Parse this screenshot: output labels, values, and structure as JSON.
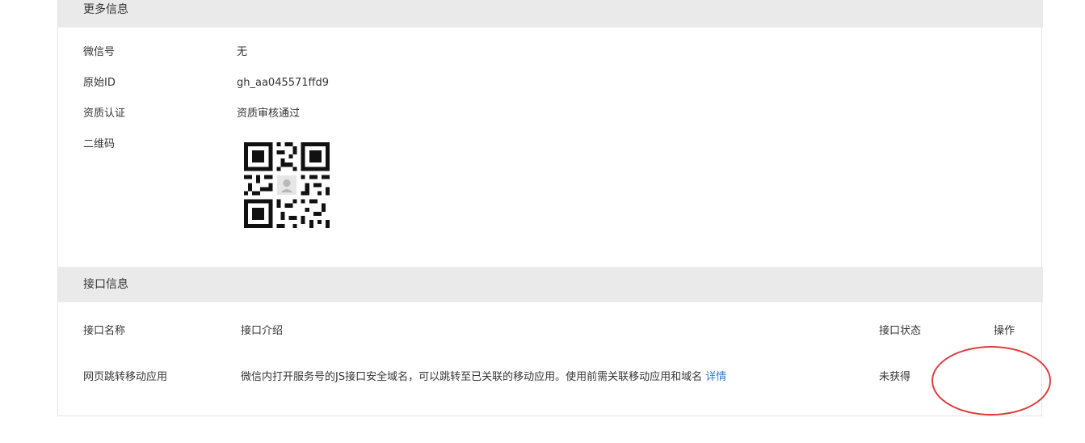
{
  "more_info": {
    "title": "更多信息",
    "rows": [
      {
        "label": "微信号",
        "value": "无"
      },
      {
        "label": "原始ID",
        "value": "gh_aa045571ffd9"
      },
      {
        "label": "资质认证",
        "value": "资质审核通过"
      },
      {
        "label": "二维码",
        "value": ""
      }
    ]
  },
  "api_info": {
    "title": "接口信息",
    "headers": {
      "name": "接口名称",
      "intro": "接口介绍",
      "status": "接口状态",
      "action": "操作"
    },
    "rows": [
      {
        "name": "网页跳转移动应用",
        "intro": "微信内打开服务号的JS接口安全域名，可以跳转至已关联的移动应用。使用前需关联移动应用和域名",
        "detail_link": "详情",
        "status": "未获得",
        "action": ""
      }
    ]
  },
  "colors": {
    "header_bg": "#eaeaea",
    "link": "#2b7bd6",
    "annotation": "#e03a3a"
  }
}
